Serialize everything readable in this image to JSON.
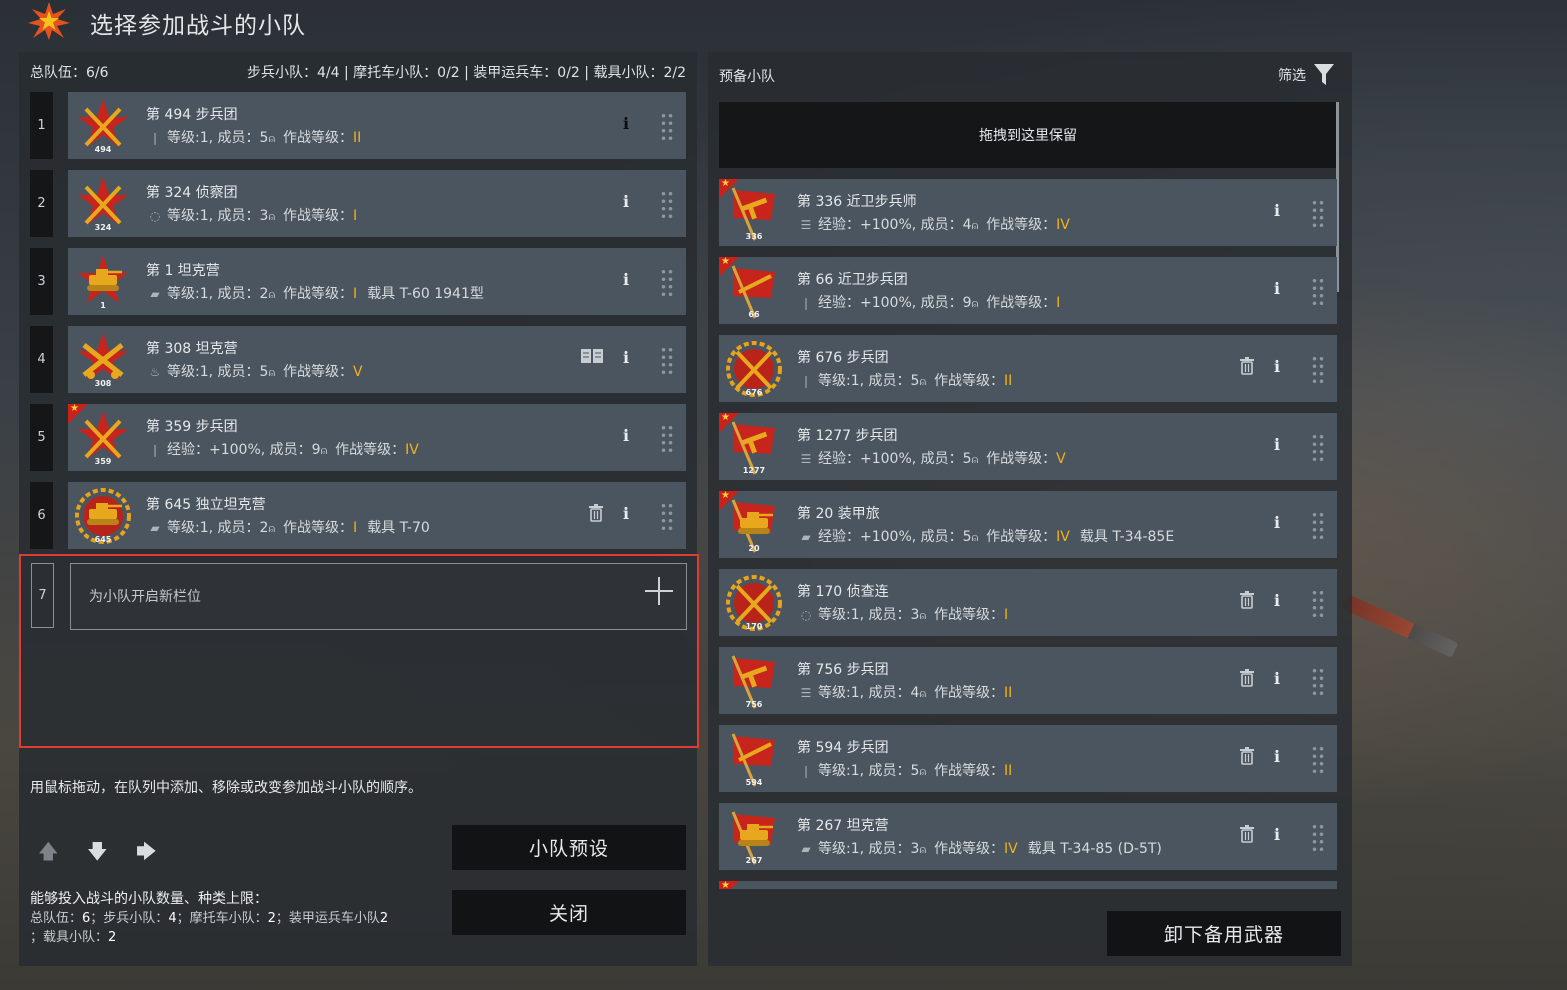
{
  "header": {
    "title": "选择参加战斗的小队",
    "logo_icon": "burst-star-icon"
  },
  "colors": {
    "accent_rank": "#f0b21a",
    "card_bg": "#4b5560",
    "highlight_border": "#e23b36",
    "flag_red": "#c8221a"
  },
  "roster": {
    "total_label": "总队伍：6/6",
    "type_counts": "步兵小队：4/4 | 摩托车小队：0/2 | 装甲运兵车：0/2 | 载具小队：2/2",
    "squads": [
      {
        "num": "1",
        "name": "第 494 步兵团",
        "badge": "494",
        "type_icon": "rifle-icon",
        "stat_label": "等级:1, 成员：5",
        "rank_label": "作战等级：",
        "rank": "II",
        "vehicle": "",
        "emblem": "star-rifles",
        "actions": [
          "info-dark"
        ]
      },
      {
        "num": "2",
        "name": "第 324 侦察团",
        "badge": "324",
        "type_icon": "crosshair-icon",
        "stat_label": "等级:1, 成员：3",
        "rank_label": "作战等级：",
        "rank": "I",
        "vehicle": "",
        "emblem": "star-rifles",
        "actions": [
          "info"
        ]
      },
      {
        "num": "3",
        "name": "第 1 坦克营",
        "badge": "1",
        "type_icon": "tank-icon",
        "stat_label": "等级:1, 成员：2",
        "rank_label": "作战等级：",
        "rank": "I",
        "vehicle": "载具 T-60 1941型",
        "emblem": "star-tank",
        "actions": [
          "info"
        ]
      },
      {
        "num": "4",
        "name": "第 308 坦克营",
        "badge": "308",
        "type_icon": "fire-icon",
        "stat_label": "等级:1, 成员：5",
        "rank_label": "作战等级：",
        "rank": "V",
        "vehicle": "",
        "emblem": "star-cannons",
        "actions": [
          "book",
          "info"
        ]
      },
      {
        "num": "5",
        "name": "第 359 步兵团",
        "badge": "359",
        "type_icon": "rifle-icon",
        "stat_label": "经验：+100%, 成员：9",
        "rank_label": "作战等级：",
        "rank": "IV",
        "vehicle": "",
        "emblem": "star-rifles",
        "corner": true,
        "actions": [
          "info"
        ]
      },
      {
        "num": "6",
        "name": "第 645 独立坦克营",
        "badge": "645",
        "type_icon": "tank-icon",
        "stat_label": "等级:1, 成员：2",
        "rank_label": "作战等级：",
        "rank": "I",
        "vehicle": "载具 T-70",
        "emblem": "wreath-tank",
        "actions": [
          "trash",
          "info"
        ]
      }
    ],
    "new_slot": {
      "num": "7",
      "label": "为小队开启新栏位"
    },
    "hint": "用鼠标拖动，在队列中添加、移除或改变参加战斗小队的顺序。",
    "preset_button": "小队预设",
    "close_button": "关闭",
    "limits_title": "能够投入战斗的小队数量、种类上限：",
    "limits_line1": "总队伍：",
    "limits_v1": "6",
    "limits_line2": "；步兵小队：",
    "limits_v2": "4",
    "limits_line3": "；摩托车小队：",
    "limits_v3": "2",
    "limits_line4": "；装甲运兵车小队",
    "limits_v4": "2",
    "limits_line5": "；载具小队：",
    "limits_v5": "2"
  },
  "reserve": {
    "title": "预备小队",
    "filter_label": "筛选",
    "dropzone": "拖拽到这里保留",
    "unload_button": "卸下备用武器",
    "squads": [
      {
        "name": "第 336 近卫步兵师",
        "badge": "336",
        "type_icon": "list-icon",
        "stat_label": "经验：+100%, 成员：4",
        "rank_label": "作战等级：",
        "rank": "IV",
        "vehicle": "",
        "emblem": "flag-smg",
        "corner": true,
        "actions": [
          "info"
        ]
      },
      {
        "name": "第 66 近卫步兵团",
        "badge": "66",
        "type_icon": "rifle-icon",
        "stat_label": "经验：+100%, 成员：9",
        "rank_label": "作战等级：",
        "rank": "I",
        "vehicle": "",
        "emblem": "flag-rifle",
        "corner": true,
        "actions": [
          "info"
        ]
      },
      {
        "name": "第 676 步兵团",
        "badge": "676",
        "type_icon": "rifle-icon",
        "stat_label": "等级:1, 成员：5",
        "rank_label": "作战等级：",
        "rank": "II",
        "vehicle": "",
        "emblem": "wreath-rifles",
        "actions": [
          "trash",
          "info"
        ]
      },
      {
        "name": "第 1277 步兵团",
        "badge": "1277",
        "type_icon": "list-icon",
        "stat_label": "经验：+100%, 成员：5",
        "rank_label": "作战等级：",
        "rank": "V",
        "vehicle": "",
        "emblem": "flag-smg",
        "corner": true,
        "actions": [
          "info"
        ]
      },
      {
        "name": "第 20 装甲旅",
        "badge": "20",
        "type_icon": "tank-icon",
        "stat_label": "经验：+100%, 成员：5",
        "rank_label": "作战等级：",
        "rank": "IV",
        "vehicle": "载具 T-34-85E",
        "emblem": "flag-tank",
        "corner": true,
        "actions": [
          "info"
        ]
      },
      {
        "name": "第 170 侦查连",
        "badge": "170",
        "type_icon": "crosshair-icon",
        "stat_label": "等级:1, 成员：3",
        "rank_label": "作战等级：",
        "rank": "I",
        "vehicle": "",
        "emblem": "wreath-rifles",
        "actions": [
          "trash",
          "info"
        ]
      },
      {
        "name": "第 756 步兵团",
        "badge": "756",
        "type_icon": "list-icon",
        "stat_label": "等级:1, 成员：4",
        "rank_label": "作战等级：",
        "rank": "II",
        "vehicle": "",
        "emblem": "flag-smg",
        "actions": [
          "trash",
          "info"
        ]
      },
      {
        "name": "第 594 步兵团",
        "badge": "594",
        "type_icon": "rifle-icon",
        "stat_label": "等级:1, 成员：5",
        "rank_label": "作战等级：",
        "rank": "II",
        "vehicle": "",
        "emblem": "flag-rifle",
        "actions": [
          "trash",
          "info"
        ]
      },
      {
        "name": "第 267 坦克营",
        "badge": "267",
        "type_icon": "tank-icon",
        "stat_label": "等级:1, 成员：3",
        "rank_label": "作战等级：",
        "rank": "IV",
        "vehicle": "载具 T-34-85 (D-5T)",
        "emblem": "flag-tank",
        "actions": [
          "trash",
          "info"
        ]
      }
    ]
  }
}
